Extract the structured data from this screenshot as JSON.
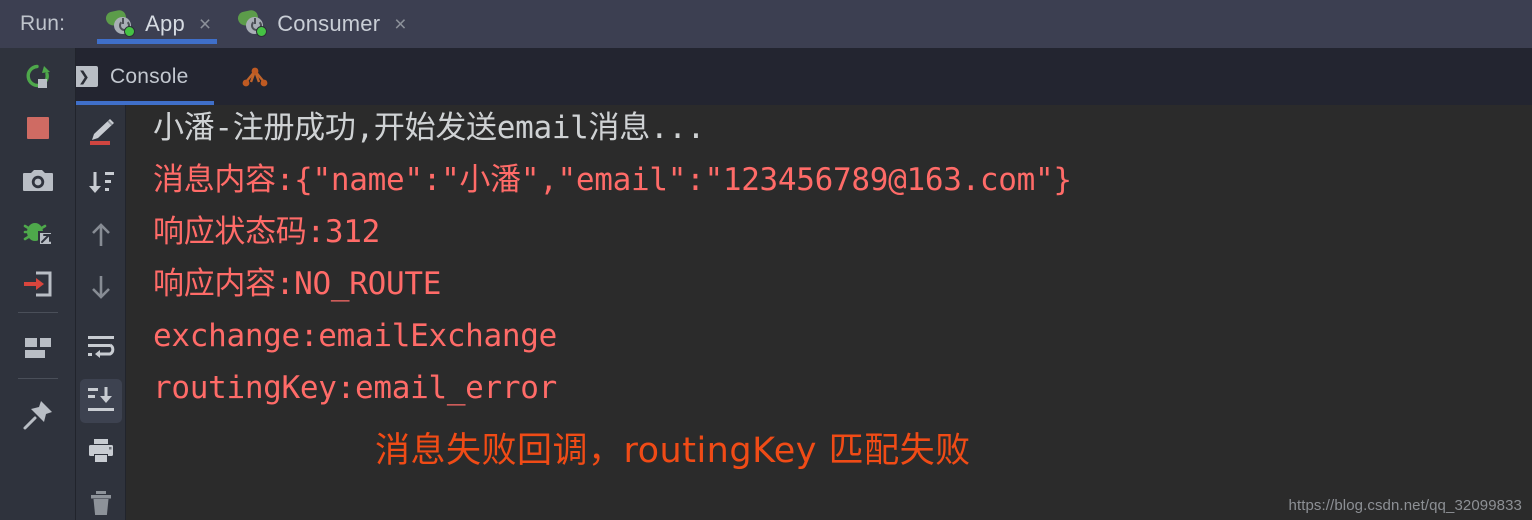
{
  "window": {
    "run_label": "Run:",
    "run_tabs": [
      {
        "label": "App",
        "icon": "spring-boot-icon",
        "close": "×",
        "active": true
      },
      {
        "label": "Consumer",
        "icon": "spring-boot-icon",
        "close": "×",
        "active": false
      }
    ]
  },
  "sub_tabs": [
    {
      "label": "Console",
      "icon": "console-icon",
      "active": true
    },
    {
      "label": "Endpoints",
      "icon": "endpoints-graph-icon",
      "active": false
    }
  ],
  "left_toolbar": {
    "buttons": [
      {
        "name": "rerun-button",
        "icon": "rerun-green-arrow-icon"
      },
      {
        "name": "stop-button",
        "icon": "stop-red-square-icon"
      },
      {
        "name": "screenshot-button",
        "icon": "camera-icon"
      },
      {
        "name": "debug-attach-button",
        "icon": "green-bug-attach-icon"
      },
      {
        "name": "thread-dump-button",
        "icon": "red-arrow-into-box-icon"
      },
      {
        "name": "layout-button",
        "icon": "restore-layout-icon"
      },
      {
        "name": "pin-tab-button",
        "icon": "pin-icon"
      }
    ]
  },
  "console_toolbar": {
    "buttons": [
      {
        "name": "highlight-button",
        "icon": "pencil-marker-icon",
        "selected": false
      },
      {
        "name": "sort-button",
        "icon": "sort-descending-icon",
        "selected": false
      },
      {
        "name": "prev-occurrence-button",
        "icon": "arrow-up-icon",
        "selected": false
      },
      {
        "name": "next-occurrence-button",
        "icon": "arrow-down-icon",
        "selected": false
      },
      {
        "name": "soft-wrap-button",
        "icon": "soft-wrap-icon",
        "selected": false
      },
      {
        "name": "scroll-to-end-button",
        "icon": "scroll-to-end-icon",
        "selected": true
      },
      {
        "name": "print-button",
        "icon": "printer-icon",
        "selected": false
      },
      {
        "name": "clear-all-button",
        "icon": "trash-icon",
        "selected": false
      }
    ]
  },
  "console": {
    "lines": [
      {
        "text": "小潘-注册成功,开始发送email消息...",
        "color": "white"
      },
      {
        "text": "消息内容:{\"name\":\"小潘\",\"email\":\"123456789@163.com\"}",
        "color": "red"
      },
      {
        "text": "响应状态码:312",
        "color": "red"
      },
      {
        "text": "响应内容:NO_ROUTE",
        "color": "red"
      },
      {
        "text": "exchange:emailExchange",
        "color": "red"
      },
      {
        "text": "routingKey:email_error",
        "color": "red"
      }
    ],
    "annotation": "消息失败回调，routingKey 匹配失败",
    "watermark": "https://blog.csdn.net/qq_32099833"
  },
  "colors": {
    "accent_blue": "#3f6fc9",
    "error_red": "#ff6b68",
    "annotation_orange": "#f04b16",
    "console_bg": "#2b2b2b",
    "toolbar_bg": "#2f333d",
    "run_bar_bg": "#3c3f51",
    "sub_tab_bg": "#232530"
  }
}
